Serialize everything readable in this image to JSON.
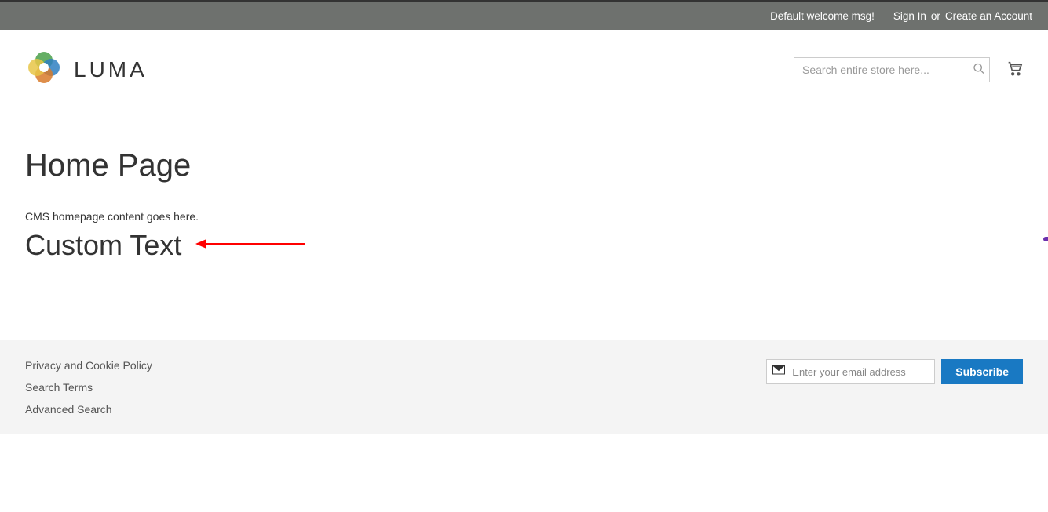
{
  "topbar": {
    "welcome": "Default welcome msg!",
    "sign_in": "Sign In",
    "or": "or",
    "create_account": "Create an Account"
  },
  "header": {
    "logo_text": "LUMA",
    "search_placeholder": "Search entire store here..."
  },
  "main": {
    "page_title": "Home Page",
    "cms_text": "CMS homepage content goes here.",
    "custom_heading": "Custom Text"
  },
  "footer": {
    "links": [
      "Privacy and Cookie Policy",
      "Search Terms",
      "Advanced Search"
    ],
    "newsletter_placeholder": "Enter your email address",
    "subscribe_label": "Subscribe"
  }
}
